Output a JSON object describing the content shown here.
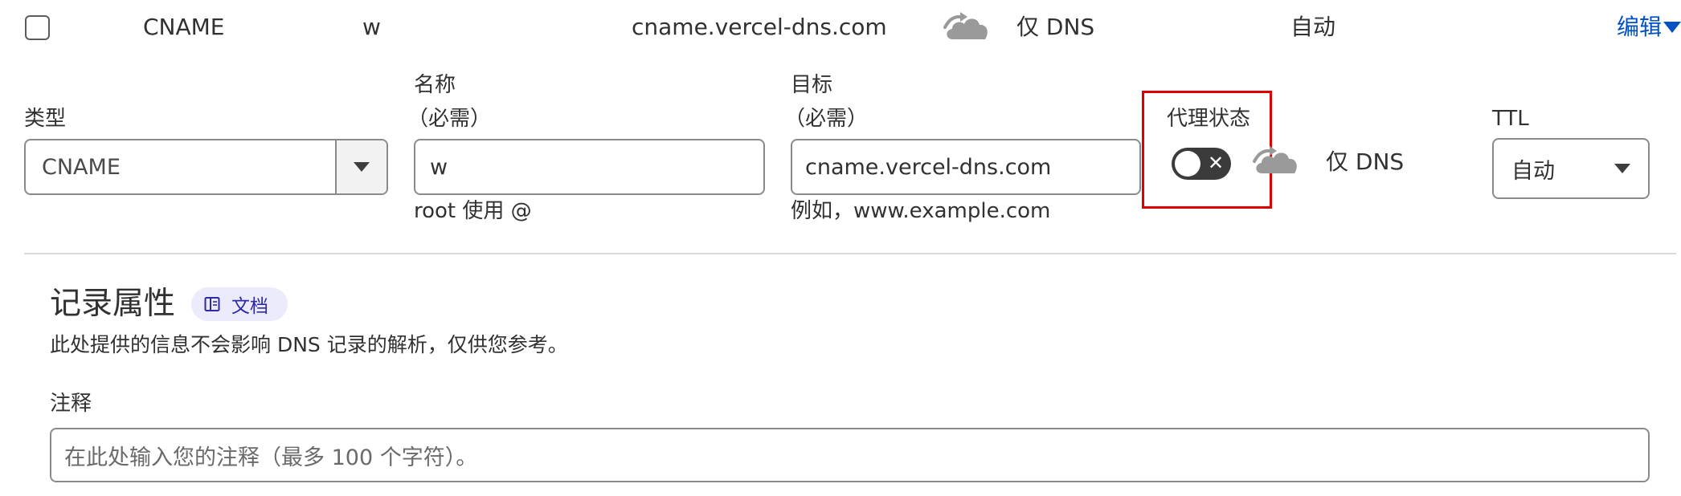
{
  "record_row": {
    "type": "CNAME",
    "name": "w",
    "content": "cname.vercel-dns.com",
    "proxy_status": "仅 DNS",
    "ttl": "自动",
    "edit_label": "编辑"
  },
  "form": {
    "type_label": "类型",
    "type_value": "CNAME",
    "name_label": "名称",
    "name_required": "（必需）",
    "name_value": "w",
    "name_hint": "root 使用 @",
    "target_label": "目标",
    "target_required": "（必需）",
    "target_value": "cname.vercel-dns.com",
    "target_hint": "例如，www.example.com",
    "proxy_label": "代理状态",
    "proxy_toggle_state": "off",
    "proxy_status_text": "仅 DNS",
    "ttl_label": "TTL",
    "ttl_value": "自动"
  },
  "record_attributes": {
    "title": "记录属性",
    "docs_label": "文档",
    "description": "此处提供的信息不会影响 DNS 记录的解析，仅供您参考。",
    "comment_label": "注释",
    "comment_placeholder": "在此处输入您的注释（最多 100 个字符）。"
  },
  "icons": {
    "proxy_cloud": "dns-only-cloud-icon",
    "docs": "book-icon",
    "dropdown": "chevron-down-icon",
    "toggle_off": "close-icon"
  },
  "colors": {
    "link": "#0051c3",
    "highlight": "#e00000",
    "cloud_gray": "#9a9a9a",
    "toggle_off": "#3b3b3b",
    "badge_bg": "#ecebfb",
    "badge_text": "#2f2aa6"
  }
}
